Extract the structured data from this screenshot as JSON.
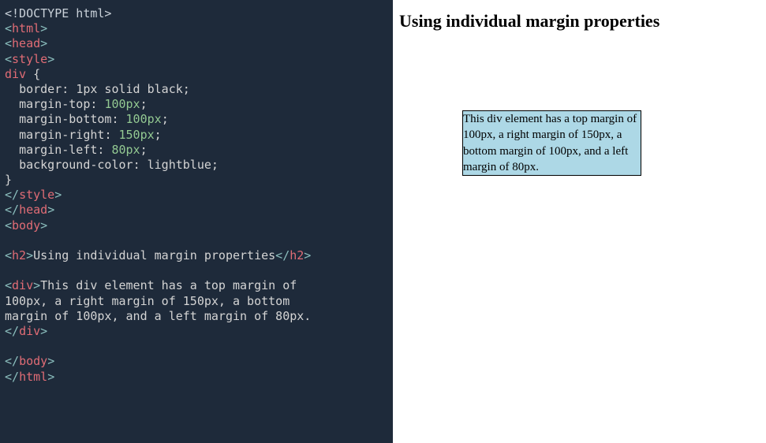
{
  "code": {
    "doctype": "<!DOCTYPE html>",
    "html_open": "html",
    "head_open": "head",
    "style_open": "style",
    "selector": "div",
    "brace_open": " {",
    "props": [
      {
        "name": "border",
        "vals": [
          {
            "t": "1px",
            "c": "w"
          },
          {
            "t": " solid",
            "c": "w"
          },
          {
            "t": " black",
            "c": "w"
          }
        ]
      },
      {
        "name": "margin-top",
        "vals": [
          {
            "t": "100px",
            "c": "g"
          }
        ]
      },
      {
        "name": "margin-bottom",
        "vals": [
          {
            "t": "100px",
            "c": "g"
          }
        ]
      },
      {
        "name": "margin-right",
        "vals": [
          {
            "t": "150px",
            "c": "g"
          }
        ]
      },
      {
        "name": "margin-left",
        "vals": [
          {
            "t": "80px",
            "c": "g"
          }
        ]
      },
      {
        "name": "background-color",
        "vals": [
          {
            "t": "lightblue",
            "c": "w"
          }
        ]
      }
    ],
    "brace_close": "}",
    "style_close": "style",
    "head_close": "head",
    "body_open": "body",
    "h2_tag": "h2",
    "h2_text": "Using individual margin properties",
    "div_tag": "div",
    "div_text_line1": "This div element has a top margin of",
    "div_text_line2": "100px, a right margin of 150px, a bottom",
    "div_text_line3": "margin of 100px, and a left margin of 80px.",
    "body_close": "body",
    "html_close": "html"
  },
  "render": {
    "heading": "Using individual margin properties",
    "box_text": "This div element has a top margin of 100px, a right margin of 150px, a bottom margin of 100px, and a left margin of 80px."
  }
}
